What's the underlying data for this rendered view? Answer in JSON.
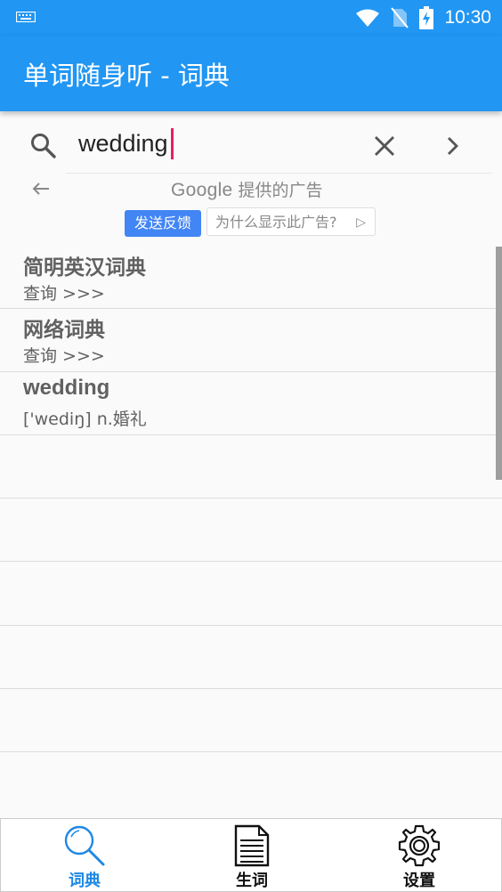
{
  "status_bar": {
    "time": "10:30",
    "icons": [
      "keyboard-icon",
      "wifi-icon",
      "no-sim-icon",
      "battery-charging-icon"
    ]
  },
  "app_bar": {
    "title": "单词随身听 - 词典"
  },
  "search": {
    "value": "wedding",
    "icons": [
      "search-icon",
      "clear-icon",
      "chevron-right-icon"
    ]
  },
  "ad": {
    "google_word": "Google",
    "provided": "提供的广告",
    "feedback_label": "发送反馈",
    "why_label": "为什么显示此广告?",
    "feedback_color": "#4285f4"
  },
  "results": [
    {
      "title": "简明英汉词典",
      "subtitle": "查询 >>>"
    },
    {
      "title": "网络词典",
      "subtitle": "查询 >>>"
    },
    {
      "title": "wedding",
      "subtitle": "['wediŋ] n.婚礼"
    }
  ],
  "bottom_nav": {
    "items": [
      {
        "label": "词典",
        "icon": "magnifier-icon",
        "active": true
      },
      {
        "label": "生词",
        "icon": "document-icon",
        "active": false
      },
      {
        "label": "设置",
        "icon": "gear-icon",
        "active": false
      }
    ]
  },
  "colors": {
    "primary": "#2196f3",
    "active_nav": "#1e88e5",
    "caret": "#e91e63"
  }
}
